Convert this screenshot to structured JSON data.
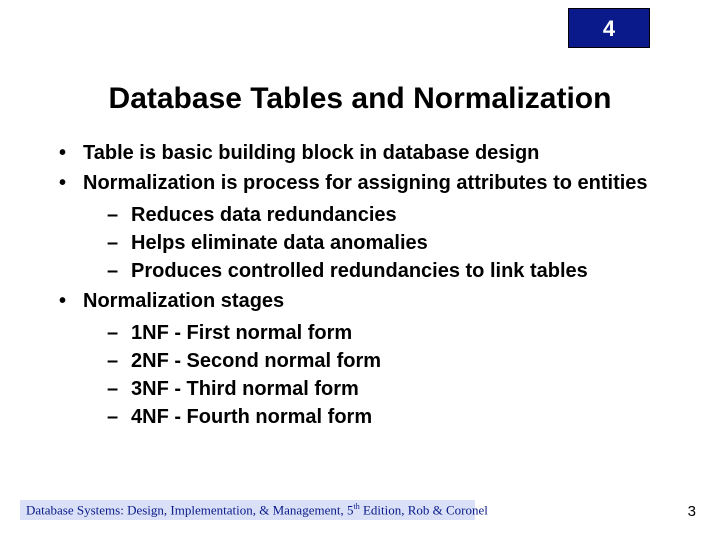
{
  "chapter": "4",
  "title": "Database Tables and Normalization",
  "bullets": {
    "b1": "Table is basic building block in database design",
    "b2": "Normalization is process for assigning attributes to entities",
    "b2s1": "Reduces data redundancies",
    "b2s2": "Helps eliminate data anomalies",
    "b2s3": "Produces controlled redundancies to link tables",
    "b3": "Normalization stages",
    "b3s1": "1NF - First normal form",
    "b3s2": "2NF - Second normal form",
    "b3s3": "3NF - Third normal form",
    "b3s4": "4NF - Fourth normal form"
  },
  "footer": {
    "pre": "Database Systems: Design, Implementation, & Management, 5",
    "sup": "th",
    "post": " Edition, Rob & Coronel"
  },
  "page": "3"
}
